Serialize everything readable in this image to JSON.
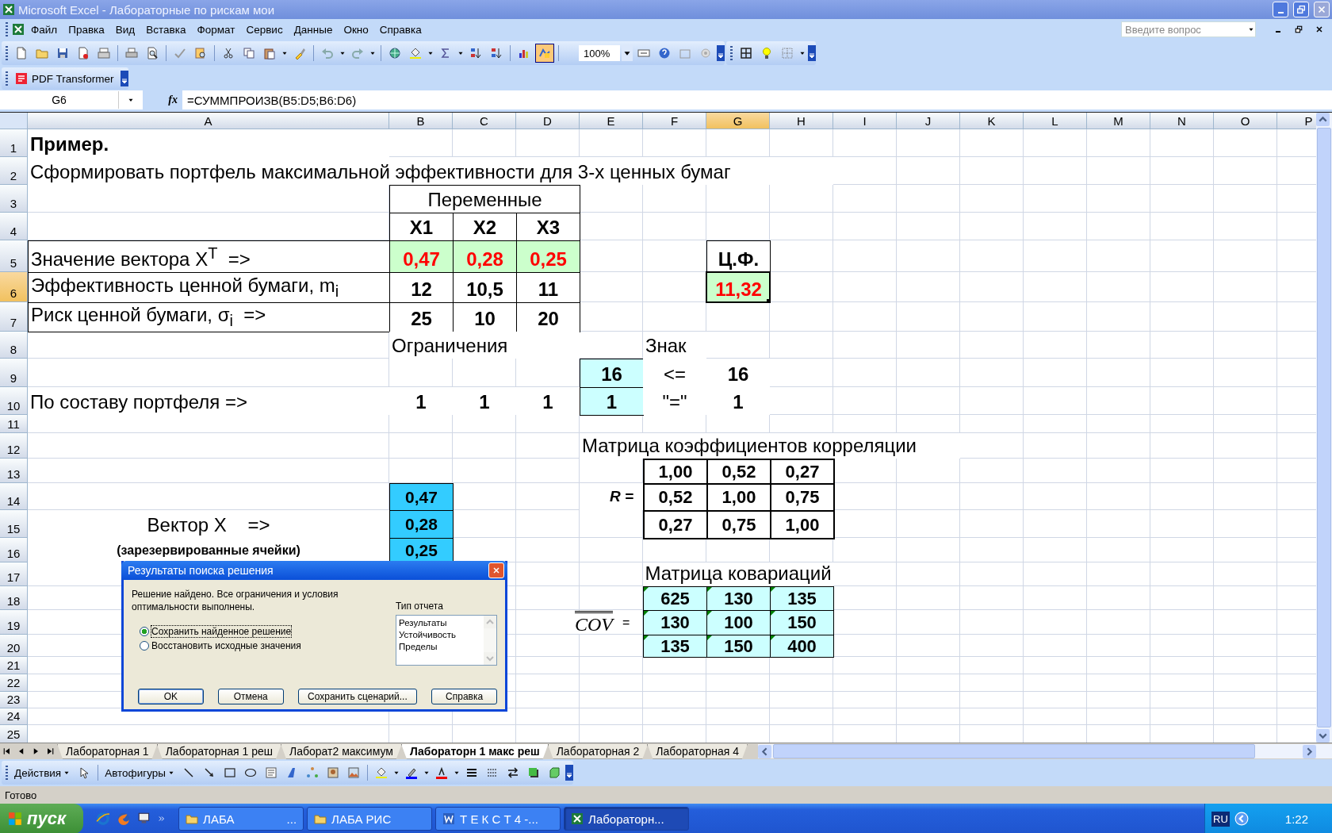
{
  "window": {
    "title": "Microsoft Excel - Лабораторные по рискам мои"
  },
  "menu": [
    "Файл",
    "Правка",
    "Вид",
    "Вставка",
    "Формат",
    "Сервис",
    "Данные",
    "Окно",
    "Справка"
  ],
  "ask_box": {
    "placeholder": "Введите вопрос"
  },
  "toolbar": {
    "zoom": "100%"
  },
  "pdf_toolbar": {
    "label": "PDF Transformer"
  },
  "formula_bar": {
    "name_box": "G6",
    "function_button": "fx",
    "formula": "=СУММПРОИЗВ(B5:D5;B6:D6)"
  },
  "sheet": {
    "columns": [
      {
        "label": "A",
        "selected": false
      },
      {
        "label": "B",
        "selected": false
      },
      {
        "label": "C",
        "selected": false
      },
      {
        "label": "D",
        "selected": false
      },
      {
        "label": "E",
        "selected": false
      },
      {
        "label": "F",
        "selected": false
      },
      {
        "label": "G",
        "selected": true
      },
      {
        "label": "H",
        "selected": false
      },
      {
        "label": "I",
        "selected": false
      },
      {
        "label": "J",
        "selected": false
      },
      {
        "label": "K",
        "selected": false
      },
      {
        "label": "L",
        "selected": false
      },
      {
        "label": "M",
        "selected": false
      },
      {
        "label": "N",
        "selected": false
      },
      {
        "label": "O",
        "selected": false
      },
      {
        "label": "P",
        "selected": false
      }
    ],
    "rows": [
      {
        "number": "1",
        "selected": false
      },
      {
        "number": "2",
        "selected": false
      },
      {
        "number": "3",
        "selected": false
      },
      {
        "number": "4",
        "selected": false
      },
      {
        "number": "5",
        "selected": false
      },
      {
        "number": "6",
        "selected": true
      },
      {
        "number": "7",
        "selected": false
      },
      {
        "number": "8",
        "selected": false
      },
      {
        "number": "9",
        "selected": false
      },
      {
        "number": "10",
        "selected": false
      },
      {
        "number": "11",
        "selected": false
      },
      {
        "number": "12",
        "selected": false
      },
      {
        "number": "13",
        "selected": false
      },
      {
        "number": "14",
        "selected": false
      },
      {
        "number": "15",
        "selected": false
      },
      {
        "number": "16",
        "selected": false
      },
      {
        "number": "17",
        "selected": false
      },
      {
        "number": "18",
        "selected": false
      },
      {
        "number": "19",
        "selected": false
      },
      {
        "number": "20",
        "selected": false
      },
      {
        "number": "21",
        "selected": false
      },
      {
        "number": "22",
        "selected": false
      },
      {
        "number": "23",
        "selected": false
      },
      {
        "number": "24",
        "selected": false
      },
      {
        "number": "25",
        "selected": false
      }
    ],
    "cells": [
      {
        "kind": "title",
        "text": "Пример."
      },
      {
        "kind": "text",
        "text": "Сформировать портфель максимальной эффективности для 3-х ценных бумаг"
      },
      {
        "kind": "header-box",
        "text": "Переменные"
      },
      {
        "kind": "box",
        "text": "X1"
      },
      {
        "kind": "box",
        "text": "X2"
      },
      {
        "kind": "box",
        "text": "X3"
      },
      {
        "kind": "label-box",
        "text": "Значение вектора X$^{T}$  =>"
      },
      {
        "kind": "var",
        "text": "0,47"
      },
      {
        "kind": "var",
        "text": "0,28"
      },
      {
        "kind": "var",
        "text": "0,25"
      },
      {
        "kind": "box",
        "text": "Ц.Ф."
      },
      {
        "kind": "label-box",
        "text": "Эффективность ценной бумаги, m$_{i}$"
      },
      {
        "kind": "box",
        "text": "12"
      },
      {
        "kind": "box",
        "text": "10,5"
      },
      {
        "kind": "box",
        "text": "11"
      },
      {
        "kind": "var",
        "text": "11,32"
      },
      {
        "kind": "label-box",
        "text": "Риск ценной бумаги, σ$_{i}$  =>"
      },
      {
        "kind": "box",
        "text": "25"
      },
      {
        "kind": "box",
        "text": "10"
      },
      {
        "kind": "box",
        "text": "20"
      },
      {
        "kind": "text",
        "text": "Ограничения"
      },
      {
        "kind": "text",
        "text": "Знак"
      },
      {
        "kind": "lhs",
        "text": "16"
      },
      {
        "kind": "sign",
        "text": "<="
      },
      {
        "kind": "plain",
        "text": "16"
      },
      {
        "kind": "text",
        "text": "По составу портфеля =>"
      },
      {
        "kind": "plain",
        "text": "1"
      },
      {
        "kind": "plain",
        "text": "1"
      },
      {
        "kind": "plain",
        "text": "1"
      },
      {
        "kind": "lhs",
        "text": "1"
      },
      {
        "kind": "sign",
        "text": "\"=\""
      },
      {
        "kind": "plain",
        "text": "1"
      },
      {
        "kind": "text",
        "text": "Матрица коэффициентов корреляции"
      },
      {
        "kind": "corr",
        "text": "1,00"
      },
      {
        "kind": "corr",
        "text": "0,52"
      },
      {
        "kind": "corr",
        "text": "0,27"
      },
      {
        "kind": "vector",
        "text": "0,47"
      },
      {
        "kind": "math",
        "text": "R ="
      },
      {
        "kind": "corr",
        "text": "0,52"
      },
      {
        "kind": "corr",
        "text": "1,00"
      },
      {
        "kind": "corr",
        "text": "0,75"
      },
      {
        "kind": "center-text",
        "text": "Вектор X    =>"
      },
      {
        "kind": "vector",
        "text": "0,28"
      },
      {
        "kind": "corr",
        "text": "0,27"
      },
      {
        "kind": "corr",
        "text": "0,75"
      },
      {
        "kind": "corr",
        "text": "1,00"
      },
      {
        "kind": "note",
        "text": "(зарезервированные ячейки)"
      },
      {
        "kind": "vector",
        "text": "0,25"
      },
      {
        "kind": "center-text",
        "text": "Матрица ковариаций"
      },
      {
        "kind": "cov",
        "text": "625"
      },
      {
        "kind": "cov",
        "text": "130"
      },
      {
        "kind": "cov",
        "text": "135"
      },
      {
        "kind": "equation",
        "text": "COV",
        "suffix": "="
      },
      {
        "kind": "cov",
        "text": "130"
      },
      {
        "kind": "cov",
        "text": "100"
      },
      {
        "kind": "cov",
        "text": "150"
      },
      {
        "kind": "cov",
        "text": "135"
      },
      {
        "kind": "cov",
        "text": "150"
      },
      {
        "kind": "cov",
        "text": "400"
      }
    ]
  },
  "dialog": {
    "title": "Результаты поиска решения",
    "message": "Решение найдено. Все ограничения и условия оптимальности выполнены.",
    "options": [
      {
        "label": "Сохранить найденное решение",
        "selected": true
      },
      {
        "label": "Восстановить исходные значения",
        "selected": false
      }
    ],
    "report_label": "Тип отчета",
    "reports": [
      "Результаты",
      "Устойчивость",
      "Пределы"
    ],
    "buttons": [
      "OK",
      "Отмена",
      "Сохранить сценарий...",
      "Справка"
    ]
  },
  "sheet_tabs": [
    {
      "label": "Лабораторная 1",
      "selected": false
    },
    {
      "label": "Лабораторная 1 реш",
      "selected": false
    },
    {
      "label": "Лаборат2 максимум",
      "selected": false
    },
    {
      "label": "Лабораторн 1 макс реш",
      "selected": true
    },
    {
      "label": "Лабораторная 2",
      "selected": false
    },
    {
      "label": "Лабораторная 4",
      "selected": false
    }
  ],
  "drawing_toolbar": {
    "actions": "Действия",
    "autoshapes": "Автофигуры"
  },
  "status_bar": "Готово",
  "taskbar": {
    "start": "пуск",
    "tasks": [
      {
        "label": "ЛАБА",
        "tail": "...",
        "kind": "folder",
        "selected": false
      },
      {
        "label": "ЛАБА РИС",
        "kind": "folder",
        "selected": false
      },
      {
        "label": "Т Е К С Т 4 -...",
        "kind": "document",
        "selected": false
      },
      {
        "label": "Лабораторн...",
        "kind": "spreadsheet",
        "selected": true
      }
    ],
    "tray": {
      "language": "RU",
      "time": "1:22"
    }
  }
}
